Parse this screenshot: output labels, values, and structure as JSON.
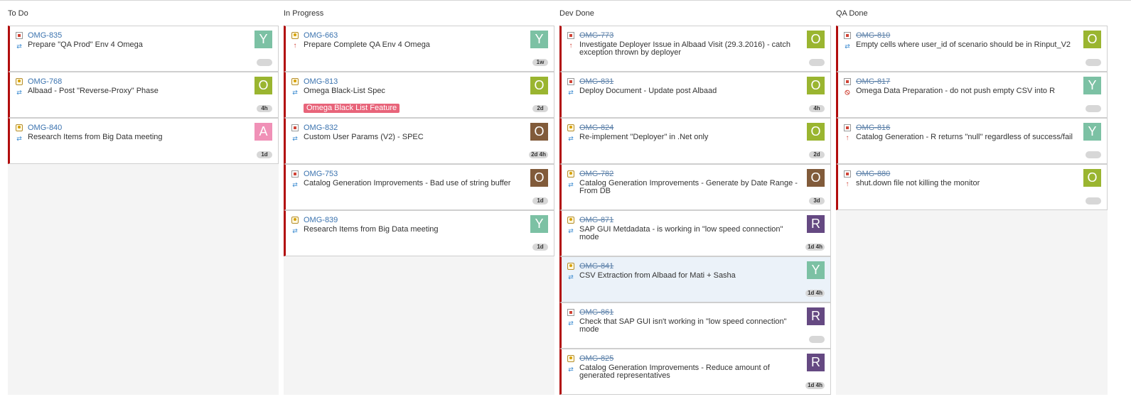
{
  "colors": {
    "card_border_red": "#b20d0d",
    "key_link": "#3b73af",
    "avatar_Y": "#7cc1a4",
    "avatar_O_green": "#9ab530",
    "avatar_O_brown": "#815b3a",
    "avatar_A": "#f091b7",
    "avatar_R": "#654982",
    "epic_badge": "#e8647a"
  },
  "columns": [
    {
      "title": "To Do",
      "cards": [
        {
          "key": "OMG-835",
          "summary": "Prepare \"QA Prod\" Env 4 Omega",
          "type": "bug",
          "priority": "minor",
          "avatar": "Y",
          "avatar_color": "#7cc1a4",
          "estimate": "",
          "done": false,
          "epic": "",
          "highlight": false
        },
        {
          "key": "OMG-768",
          "summary": "Albaad - Post \"Reverse-Proxy\" Phase",
          "type": "improvement",
          "priority": "minor",
          "avatar": "O",
          "avatar_color": "#9ab530",
          "estimate": "4h",
          "done": false,
          "epic": "",
          "highlight": false
        },
        {
          "key": "OMG-840",
          "summary": "Research Items from Big Data meeting",
          "type": "improvement",
          "priority": "minor",
          "avatar": "A",
          "avatar_color": "#f091b7",
          "estimate": "1d",
          "done": false,
          "epic": "",
          "highlight": false
        }
      ]
    },
    {
      "title": "In Progress",
      "cards": [
        {
          "key": "OMG-663",
          "summary": "Prepare Complete QA Env 4 Omega",
          "type": "improvement",
          "priority": "major",
          "avatar": "Y",
          "avatar_color": "#7cc1a4",
          "estimate": "1w",
          "done": false,
          "epic": "",
          "highlight": false
        },
        {
          "key": "OMG-813",
          "summary": "Omega Black-List Spec",
          "type": "improvement",
          "priority": "minor",
          "avatar": "O",
          "avatar_color": "#9ab530",
          "estimate": "2d",
          "done": false,
          "epic": "Omega Black List Feature",
          "highlight": false
        },
        {
          "key": "OMG-832",
          "summary": "Custom User Params (V2) - SPEC",
          "type": "bug",
          "priority": "minor",
          "avatar": "O",
          "avatar_color": "#815b3a",
          "estimate": "2d 4h",
          "done": false,
          "epic": "",
          "highlight": false
        },
        {
          "key": "OMG-753",
          "summary": "Catalog Generation Improvements - Bad use of string buffer",
          "type": "bug",
          "priority": "minor",
          "avatar": "O",
          "avatar_color": "#815b3a",
          "estimate": "1d",
          "done": false,
          "epic": "",
          "highlight": false
        },
        {
          "key": "OMG-839",
          "summary": "Research Items from Big Data meeting",
          "type": "improvement",
          "priority": "minor",
          "avatar": "Y",
          "avatar_color": "#7cc1a4",
          "estimate": "1d",
          "done": false,
          "epic": "",
          "highlight": false
        }
      ]
    },
    {
      "title": "Dev Done",
      "cards": [
        {
          "key": "OMG-773",
          "summary": "Investigate Deployer Issue in Albaad Visit (29.3.2016) - catch exception thrown by deployer",
          "type": "bug",
          "priority": "major",
          "avatar": "O",
          "avatar_color": "#9ab530",
          "estimate": "",
          "done": true,
          "epic": "",
          "highlight": false
        },
        {
          "key": "OMG-831",
          "summary": "Deploy Document - Update post Albaad",
          "type": "bug",
          "priority": "minor",
          "avatar": "O",
          "avatar_color": "#9ab530",
          "estimate": "4h",
          "done": true,
          "epic": "",
          "highlight": false
        },
        {
          "key": "OMG-824",
          "summary": "Re-implement \"Deployer\" in .Net only",
          "type": "improvement",
          "priority": "minor",
          "avatar": "O",
          "avatar_color": "#9ab530",
          "estimate": "2d",
          "done": true,
          "epic": "",
          "highlight": false
        },
        {
          "key": "OMG-782",
          "summary": "Catalog Generation Improvements - Generate by Date Range - From DB",
          "type": "improvement",
          "priority": "minor",
          "avatar": "O",
          "avatar_color": "#815b3a",
          "estimate": "3d",
          "done": true,
          "epic": "",
          "highlight": false
        },
        {
          "key": "OMG-871",
          "summary": "SAP GUI Metdadata - is working in \"low speed connection\" mode",
          "type": "improvement",
          "priority": "minor",
          "avatar": "R",
          "avatar_color": "#654982",
          "estimate": "1d 4h",
          "done": true,
          "epic": "",
          "highlight": false
        },
        {
          "key": "OMG-841",
          "summary": "CSV Extraction from Albaad for Mati + Sasha",
          "type": "improvement",
          "priority": "minor",
          "avatar": "Y",
          "avatar_color": "#7cc1a4",
          "estimate": "1d 4h",
          "done": true,
          "epic": "",
          "highlight": true
        },
        {
          "key": "OMG-861",
          "summary": "Check that SAP GUI isn't working in \"low speed connection\" mode",
          "type": "bug",
          "priority": "minor",
          "avatar": "R",
          "avatar_color": "#654982",
          "estimate": "",
          "done": true,
          "epic": "",
          "highlight": false
        },
        {
          "key": "OMG-825",
          "summary": "Catalog Generation Improvements - Reduce amount of generated representatives",
          "type": "improvement",
          "priority": "minor",
          "avatar": "R",
          "avatar_color": "#654982",
          "estimate": "1d 4h",
          "done": true,
          "epic": "",
          "highlight": false
        }
      ]
    },
    {
      "title": "QA Done",
      "cards": [
        {
          "key": "OMG-810",
          "summary": "Empty cells where user_id of scenario should be in Rinput_V2",
          "type": "bug",
          "priority": "minor",
          "avatar": "O",
          "avatar_color": "#9ab530",
          "estimate": "",
          "done": true,
          "epic": "",
          "highlight": false
        },
        {
          "key": "OMG-817",
          "summary": "Omega Data Preparation - do not push empty CSV into R",
          "type": "bug",
          "priority": "blocker",
          "avatar": "Y",
          "avatar_color": "#7cc1a4",
          "estimate": "",
          "done": true,
          "epic": "",
          "highlight": false
        },
        {
          "key": "OMG-816",
          "summary": "Catalog Generation - R returns \"null\" regardless of success/fail",
          "type": "bug",
          "priority": "major",
          "avatar": "Y",
          "avatar_color": "#7cc1a4",
          "estimate": "",
          "done": true,
          "epic": "",
          "highlight": false
        },
        {
          "key": "OMG-880",
          "summary": "shut.down file not killing the monitor",
          "type": "bug",
          "priority": "major",
          "avatar": "O",
          "avatar_color": "#9ab530",
          "estimate": "",
          "done": true,
          "epic": "",
          "highlight": false
        }
      ]
    }
  ]
}
